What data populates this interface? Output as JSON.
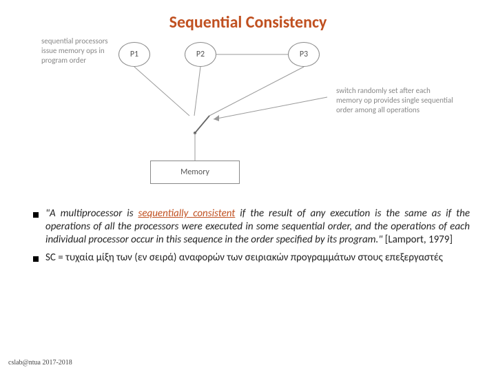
{
  "title": "Sequential Consistency",
  "diagram": {
    "seq_label": "sequential processors issue memory ops in program order",
    "p1": "P1",
    "p2": "P2",
    "p3": "P3",
    "switch_label": "switch randomly set after each memory op provides single sequential order among all operations",
    "memory": "Memory"
  },
  "bullets": [
    {
      "quote_pre": "\"A multiprocessor is ",
      "seq_word": "sequentially consistent",
      "quote_post": " if the result of any execution is the same as if the operations of all the processors were executed in some sequential order, and the operations of each individual processor occur in this sequence in the order specified by its program.\"",
      "cite": " [Lamport, 1979]"
    },
    {
      "text": "SC = τυχαία μίξη των (εν σειρά) αναφορών των σειριακών προγραμμάτων στους επεξεργαστές"
    }
  ],
  "footer": "cslab@ntua 2017-2018"
}
